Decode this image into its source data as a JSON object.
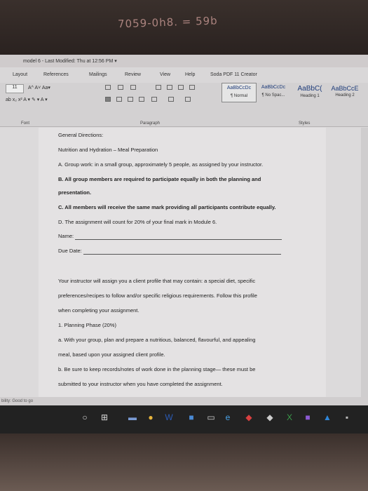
{
  "handwriting": "7059-0h8. = 59b",
  "titlebar": {
    "text": "model 6 - Last Modified: Thu at 12:56 PM ▾"
  },
  "menu": [
    "Layout",
    "References",
    "Mailings",
    "Review",
    "View",
    "Help",
    "Soda PDF 11 Creator"
  ],
  "ribbon": {
    "font_size": "11",
    "font_controls": "A^  A˅   Aa▾",
    "format_controls": "ab  x₂  x²   A ▾   ✎ ▾   A ▾",
    "styles": [
      {
        "sample": "AaBbCcDc",
        "name": "¶ Normal"
      },
      {
        "sample": "AaBbCcDc",
        "name": "¶ No Spac..."
      },
      {
        "sample": "AaBbC(",
        "name": "Heading 1"
      },
      {
        "sample": "AaBbCcE",
        "name": "Heading 2"
      }
    ],
    "groups": {
      "font": "Font",
      "paragraph": "Paragraph",
      "styles": "Styles"
    }
  },
  "document": {
    "lines": [
      {
        "text": "General Directions:",
        "bold": false
      },
      {
        "text": "Nutrition and Hydration – Meal Preparation",
        "bold": false
      },
      {
        "text": "A. Group work: in a small group, approximately 5 people, as assigned by your instructor.",
        "bold": false
      },
      {
        "text": "B. All group members are required to participate equally in both the planning and",
        "bold": true
      },
      {
        "text": "presentation.",
        "bold": true
      },
      {
        "text": "C. All members will receive the same mark providing all participants contribute equally.",
        "bold": true
      },
      {
        "text": "D. The assignment will count for 20% of your final mark in Module 6.",
        "bold": false
      },
      {
        "text": "Name:",
        "bold": false
      },
      {
        "text": "Due Date:",
        "bold": false
      },
      {
        "text": "Your instructor will assign you a client profile that may contain: a special diet, specific",
        "bold": false
      },
      {
        "text": "preferences/recipes to follow and/or specific religious requirements. Follow this profile",
        "bold": false
      },
      {
        "text": "when completing your assignment.",
        "bold": false
      },
      {
        "text": "1. Planning Phase (20%)",
        "bold": false
      },
      {
        "text": "a. With your group, plan and prepare a nutritious, balanced, flavourful, and appealing",
        "bold": false
      },
      {
        "text": "meal, based upon your assigned client profile.",
        "bold": false
      },
      {
        "text": "b. Be sure to keep records/notes of work done in the planning stage— these must be",
        "bold": false
      },
      {
        "text": "submitted to your instructor when you have completed the assignment.",
        "bold": false
      }
    ]
  },
  "status": {
    "text": "bility: Good to go"
  }
}
